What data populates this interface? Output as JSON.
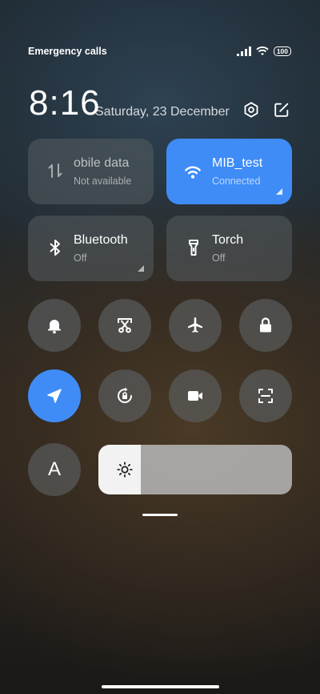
{
  "status_bar": {
    "left_text": "Emergency calls o",
    "battery": "100"
  },
  "header": {
    "time": "8:16",
    "date": "Saturday, 23 December"
  },
  "tiles": [
    {
      "name": "obile data",
      "status": "Not available",
      "icon": "mobile-data-icon",
      "active": false
    },
    {
      "name": "MIB_test",
      "status": "Connected",
      "icon": "wifi-icon",
      "active": true
    },
    {
      "name": "Bluetooth",
      "status": "Off",
      "icon": "bluetooth-icon",
      "active": false
    },
    {
      "name": "Torch",
      "status": "Off",
      "icon": "torch-icon",
      "active": false
    }
  ],
  "toggles_row1": [
    "bell-icon",
    "screenshot-scissors-icon",
    "airplane-icon",
    "lock-icon"
  ],
  "toggles_row2": [
    "location-icon",
    "auto-rotate-icon",
    "video-camera-icon",
    "scan-icon"
  ],
  "reading_mode": {
    "label": "A"
  },
  "brightness": {
    "level": 0.22,
    "icon": "sun-icon"
  },
  "colors": {
    "accent": "#3f8cf7"
  }
}
